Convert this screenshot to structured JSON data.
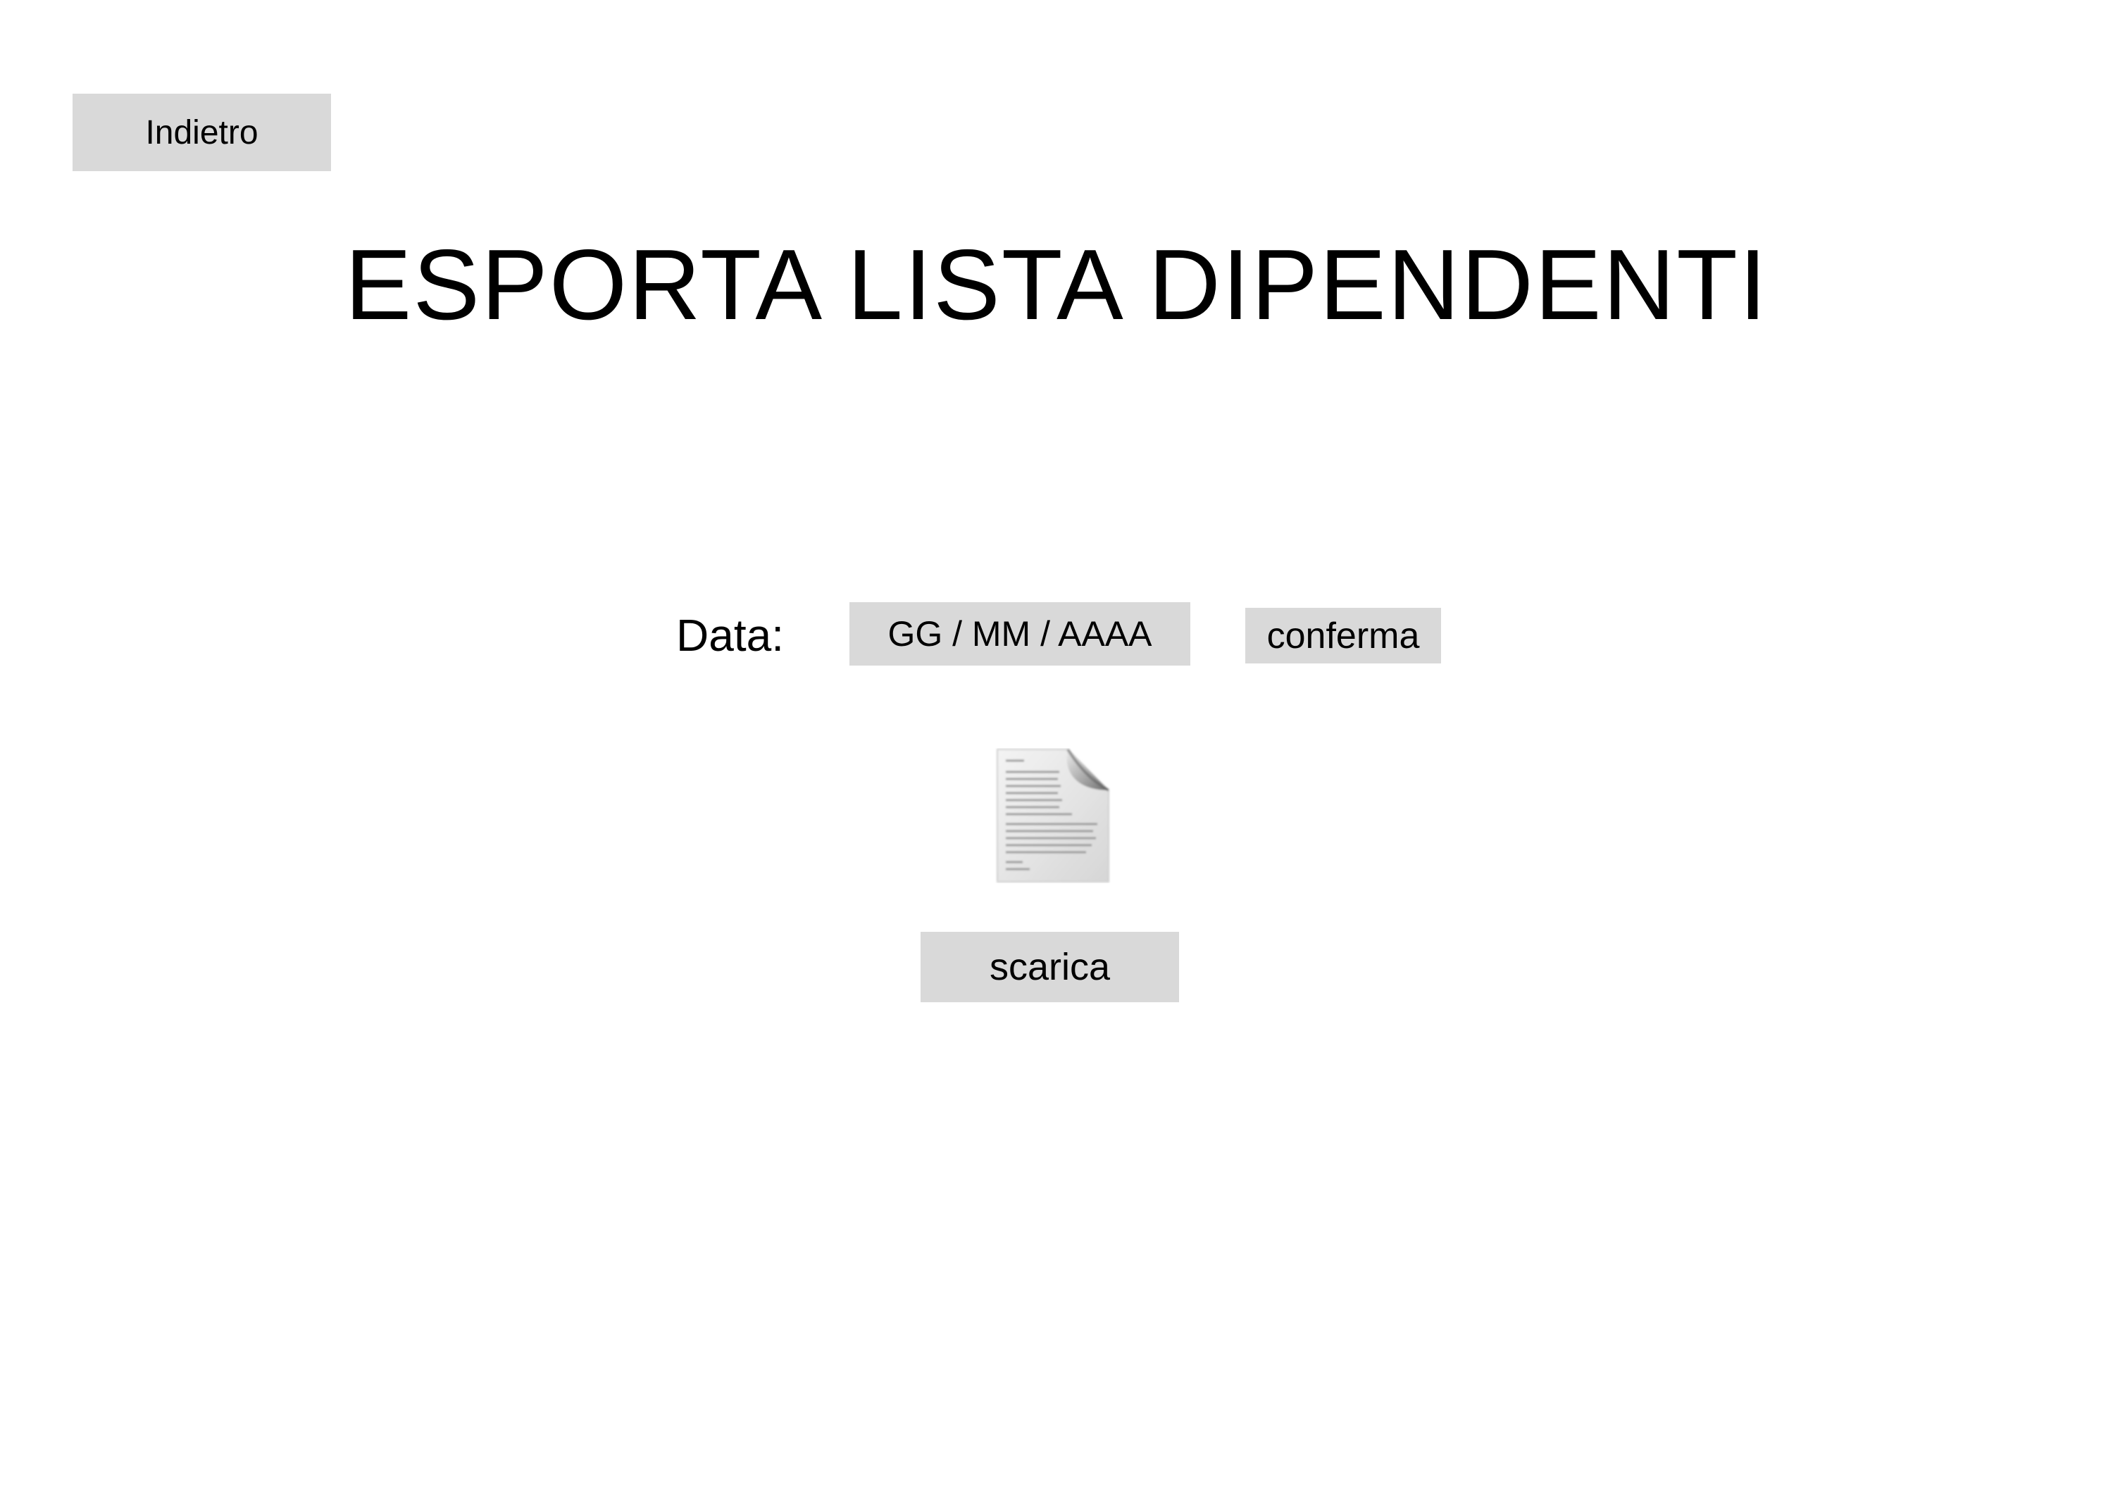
{
  "header": {
    "back_label": "Indietro",
    "title": "ESPORTA LISTA DIPENDENTI"
  },
  "date_form": {
    "label": "Data:",
    "input_placeholder": "GG / MM / AAAA",
    "input_value": "",
    "confirm_label": "conferma"
  },
  "download": {
    "file_icon": "document-icon",
    "download_label": "scarica"
  },
  "colors": {
    "button_background": "#d9d9d9",
    "page_background": "#ffffff",
    "text": "#000000"
  }
}
